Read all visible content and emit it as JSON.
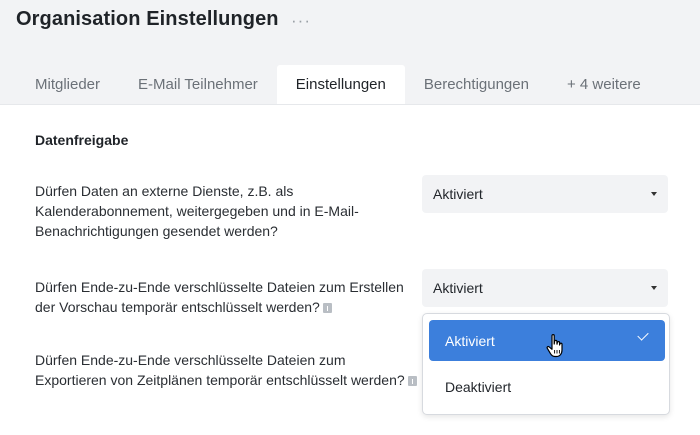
{
  "header": {
    "title": "Organisation Einstellungen",
    "more_label": "···"
  },
  "tabs": [
    {
      "label": "Mitglieder",
      "active": false
    },
    {
      "label": "E-Mail Teilnehmer",
      "active": false
    },
    {
      "label": "Einstellungen",
      "active": true
    },
    {
      "label": "Berechtigungen",
      "active": false
    },
    {
      "label": "+ 4 weitere",
      "active": false
    }
  ],
  "section": {
    "title": "Datenfreigabe"
  },
  "settings": [
    {
      "question": "Dürfen Daten an externe Dienste, z.B. als Kalenderabonnement, weitergegeben und in E-Mail-Benachrichtigungen gesendet werden?",
      "value": "Aktiviert",
      "has_info": false
    },
    {
      "question": "Dürfen Ende-zu-Ende verschlüsselte Dateien zum Erstellen der Vorschau temporär entschlüsselt werden?",
      "value": "Aktiviert",
      "has_info": true
    },
    {
      "question": "Dürfen Ende-zu-Ende verschlüsselte Dateien zum Exportieren von Zeitplänen temporär entschlüsselt werden?",
      "value": "Aktiviert",
      "has_info": true
    }
  ],
  "dropdown": {
    "options": [
      {
        "label": "Aktiviert",
        "selected": true
      },
      {
        "label": "Deaktiviert",
        "selected": false
      }
    ]
  },
  "colors": {
    "accent": "#3c7fdc",
    "background": "#f2f3f5",
    "surface": "#ffffff"
  },
  "icons": {
    "more": "ellipsis-icon",
    "info": "info-icon",
    "caret": "caret-down-icon",
    "check": "checkmark-icon",
    "cursor": "hand-pointer-icon"
  }
}
